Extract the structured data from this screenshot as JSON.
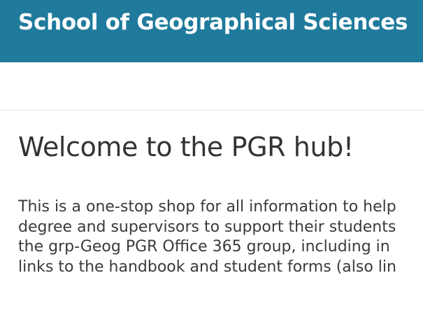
{
  "header": {
    "title": "School of Geographical Sciences",
    "background": "#1f7a9c"
  },
  "main": {
    "heading": "Welcome to the PGR hub!",
    "intro_lines": [
      "This is a one-stop shop for all information to help",
      "degree and supervisors to support their students",
      "the grp-Geog PGR Office 365 group, including in",
      "links to the handbook and student forms (also lin"
    ]
  }
}
